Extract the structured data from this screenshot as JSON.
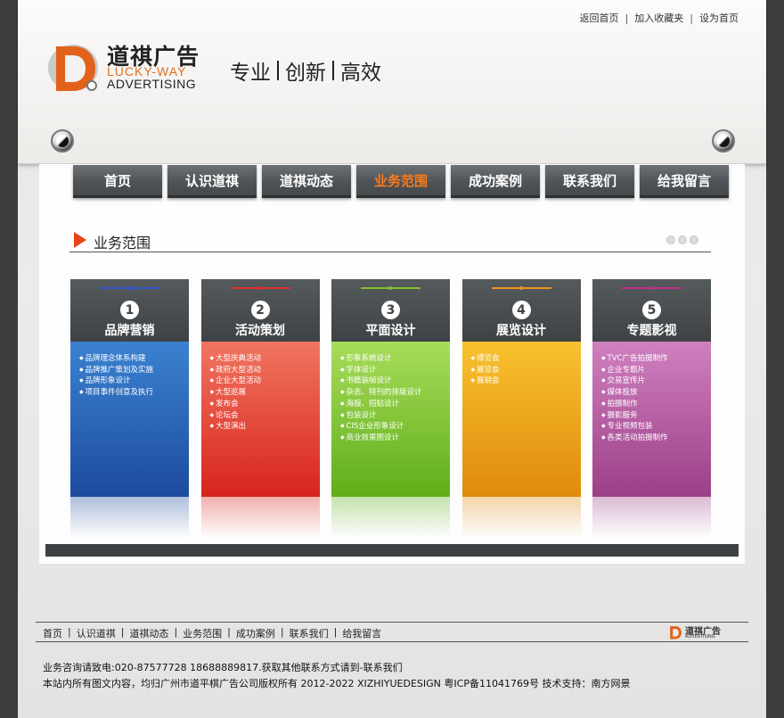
{
  "top_links": [
    "返回首页",
    "加入收藏夹",
    "设为首页"
  ],
  "logo": {
    "cn": "道祺广告",
    "en1": "LUCKY-WAY",
    "en2": "ADVERTISING"
  },
  "slogan": [
    "专业",
    "创新",
    "高效"
  ],
  "nav": [
    {
      "label": "首页",
      "active": false
    },
    {
      "label": "认识道祺",
      "active": false
    },
    {
      "label": "道祺动态",
      "active": false
    },
    {
      "label": "业务范围",
      "active": true
    },
    {
      "label": "成功案例",
      "active": false
    },
    {
      "label": "联系我们",
      "active": false
    },
    {
      "label": "给我留言",
      "active": false
    }
  ],
  "section_title": "业务范围",
  "cards": [
    {
      "num": "1",
      "title": "品牌营销",
      "accent": "#2f5fb8",
      "top": "#3b82d0",
      "bottom": "#1d4b9e",
      "line": "#3355cc",
      "items": [
        "品牌理念体系构建",
        "品牌推广策划及实施",
        "品牌形象设计",
        "项目事件创意及执行"
      ]
    },
    {
      "num": "2",
      "title": "活动策划",
      "accent": "#e03a2e",
      "top": "#f07560",
      "bottom": "#d8241c",
      "line": "#e03030",
      "items": [
        "大型庆典活动",
        "政府大型活动",
        "企业大型活动",
        "大型巡展",
        "发布会",
        "论坛会",
        "大型演出"
      ]
    },
    {
      "num": "3",
      "title": "平面设计",
      "accent": "#7ec22a",
      "top": "#a8dc5a",
      "bottom": "#5fae1a",
      "line": "#7ec22a",
      "items": [
        "形象系统设计",
        "字体设计",
        "书籍装帧设计",
        "杂志、特刊的排版设计",
        "海报、招贴设计",
        "包装设计",
        "CIS企业形象设计",
        "商业效果图设计"
      ]
    },
    {
      "num": "4",
      "title": "展览设计",
      "accent": "#f0a010",
      "top": "#f8c230",
      "bottom": "#e08a0c",
      "line": "#f09020",
      "items": [
        "博览会",
        "展览会",
        "展销会"
      ]
    },
    {
      "num": "5",
      "title": "专题影视",
      "accent": "#b45aa0",
      "top": "#cf80bf",
      "bottom": "#9c3f88",
      "line": "#c0308a",
      "items": [
        "TVC广告拍摄制作",
        "企业专题片",
        "交易宣传片",
        "媒体投放",
        "拍摄制作",
        "摄影服务",
        "专业视频包装",
        "各类活动拍摄制作"
      ]
    }
  ],
  "footer_links": [
    "首页",
    "认识道祺",
    "道祺动态",
    "业务范围",
    "成功案例",
    "联系我们",
    "给我留言"
  ],
  "footer_logo": {
    "cn": "道祺广告",
    "en": "ADVERTISING"
  },
  "contact_line": "业务咨询请致电:020-87577728 18688889817.获取其他联系方式请到-联系我们",
  "copyright_line": "本站内所有图文内容，均归广州市道平棋广告公司版权所有 2012-2022 XIZHIYUEDESIGN 粤ICP备11041769号 技术支持：南方网景"
}
